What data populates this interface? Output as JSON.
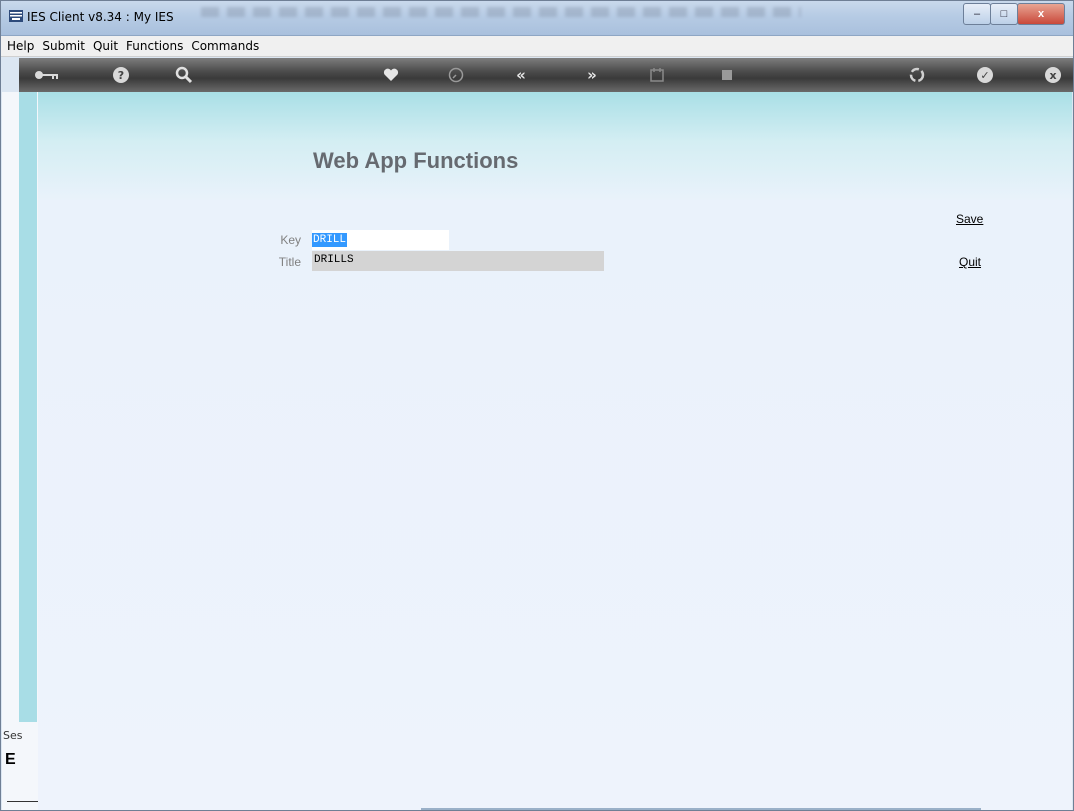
{
  "window": {
    "title": "IES Client v8.34 : My IES",
    "controls": {
      "minimize": "–",
      "maximize": "□",
      "close": "x"
    }
  },
  "menubar": {
    "items": [
      {
        "label": "Help"
      },
      {
        "label": "Submit"
      },
      {
        "label": "Quit"
      },
      {
        "label": "Functions"
      },
      {
        "label": "Commands"
      }
    ]
  },
  "toolbar": {
    "icons": [
      "key-icon",
      "help-icon",
      "search-icon",
      "heart-icon",
      "clock-icon",
      "rewind-icon",
      "forward-icon",
      "calendar-icon",
      "square-icon",
      "recycle-icon",
      "check-icon",
      "close-icon"
    ]
  },
  "main": {
    "page_title": "Web App Functions",
    "key_label": "Key",
    "key_value": "DRILL",
    "title_label": "Title",
    "title_value": "DRILLS",
    "save_label": "Save",
    "quit_label": "Quit"
  },
  "sidebar": {
    "session_label": "Ses",
    "glyph": "E"
  },
  "colors": {
    "accent_teal": "#a8dde6",
    "toolbar_dark": "#4b4b4b",
    "selection_blue": "#3399ff"
  }
}
